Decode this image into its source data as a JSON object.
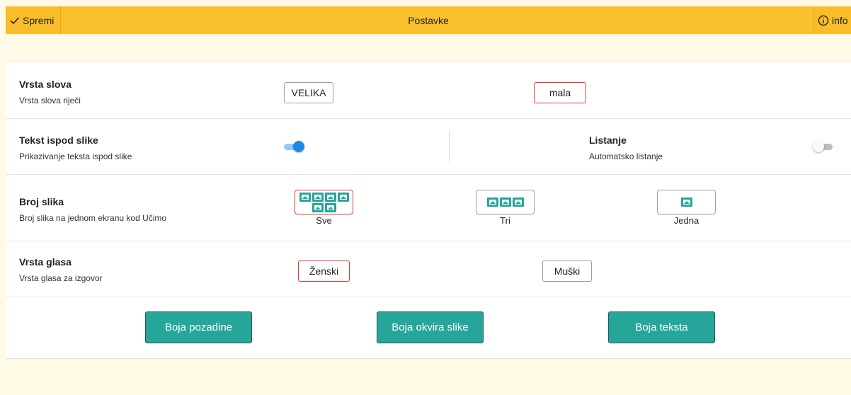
{
  "toolbar": {
    "save_label": "Spremi",
    "title": "Postavke",
    "info_label": "info"
  },
  "settings": {
    "font_case": {
      "title": "Vrsta slova",
      "subtitle": "Vrsta slova riječi",
      "options": [
        "VELIKA",
        "mala"
      ],
      "selected": "mala"
    },
    "text_below_image": {
      "title": "Tekst ispod slike",
      "subtitle": "Prikazivanje teksta ispod slike",
      "enabled": true
    },
    "auto_scroll": {
      "title": "Listanje",
      "subtitle": "Automatsko listanje",
      "enabled": false
    },
    "image_count": {
      "title": "Broj slika",
      "subtitle": "Broj slika na jednom ekranu kod Učimo",
      "options": [
        "Sve",
        "Tri",
        "Jedna"
      ],
      "selected": "Sve"
    },
    "voice": {
      "title": "Vrsta glasa",
      "subtitle": "Vrsta glasa za izgovor",
      "options": [
        "Ženski",
        "Muški"
      ],
      "selected": "Ženski"
    }
  },
  "color_buttons": [
    "Boja pozadine",
    "Boja okvira slike",
    "Boja teksta"
  ],
  "colors": {
    "toolbar": "#fbc02d",
    "page_background": "#fff9e5",
    "accent_teal": "#26a69a",
    "selected_border": "#e53935",
    "switch_on": "#1e88e5"
  }
}
